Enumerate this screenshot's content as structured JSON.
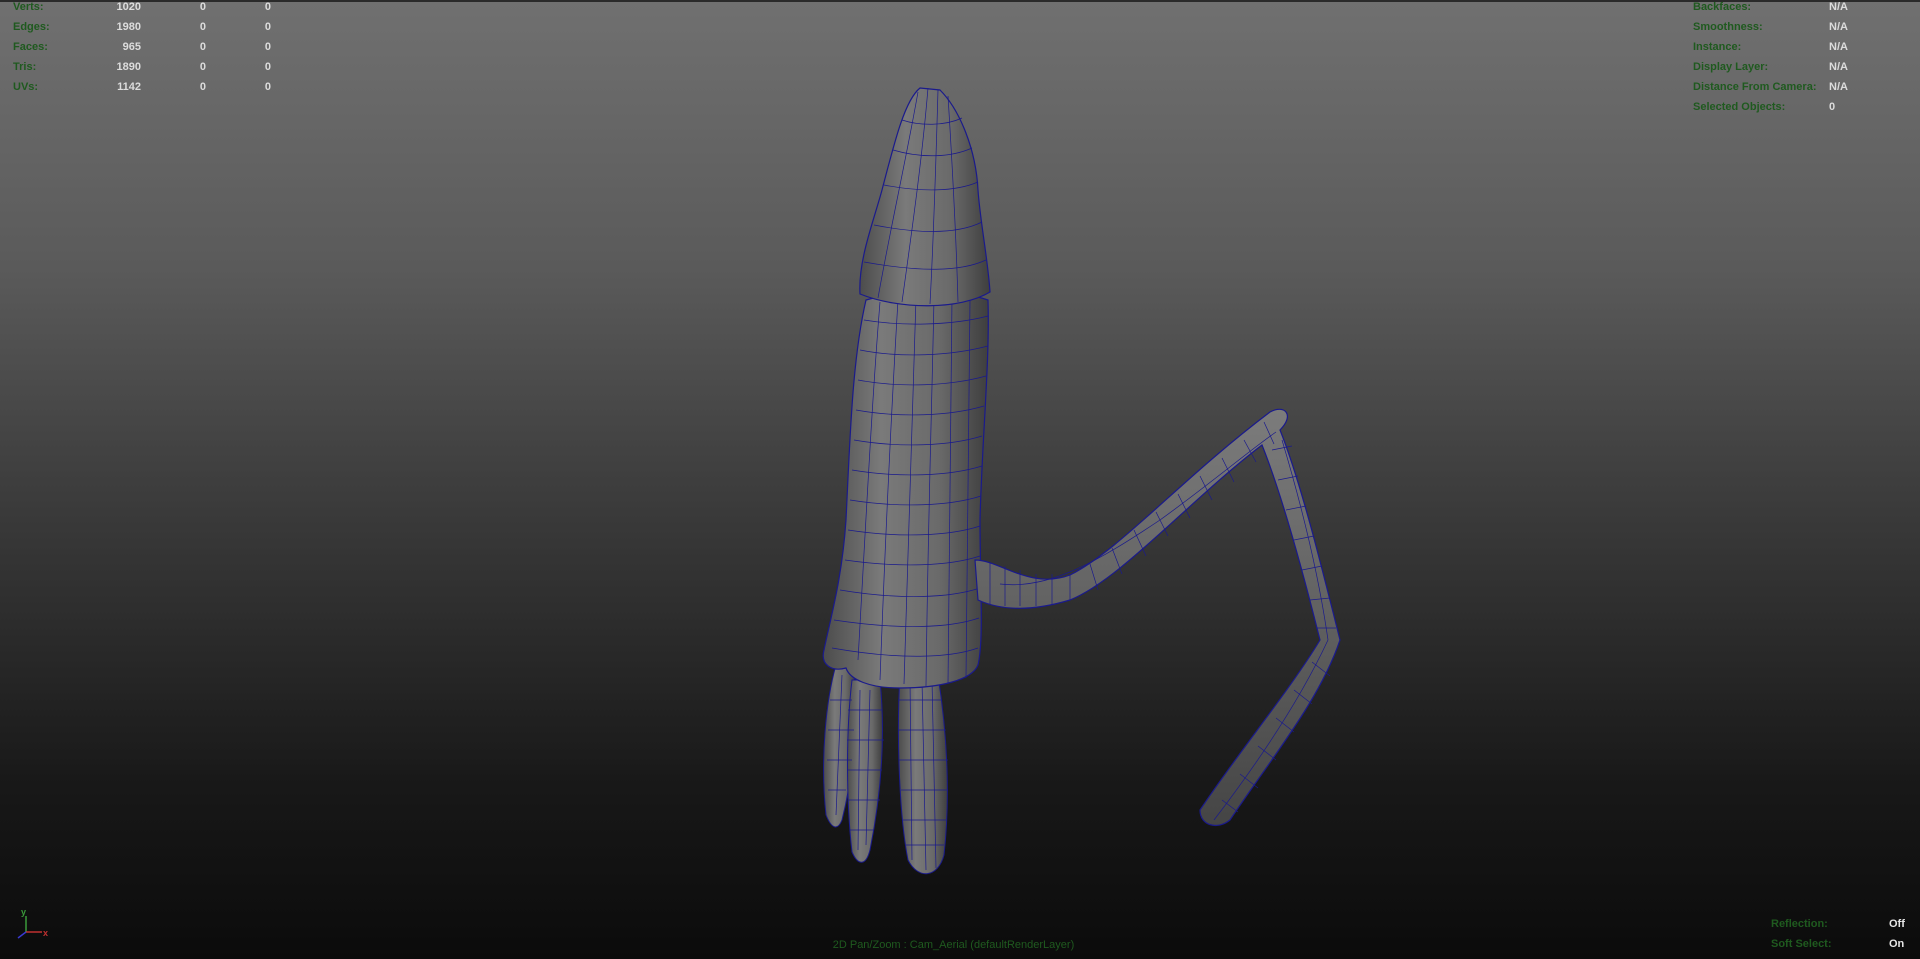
{
  "poly_count": {
    "rows": [
      {
        "label": "Verts:",
        "values": [
          "1020",
          "0",
          "0"
        ]
      },
      {
        "label": "Edges:",
        "values": [
          "1980",
          "0",
          "0"
        ]
      },
      {
        "label": "Faces:",
        "values": [
          "965",
          "0",
          "0"
        ]
      },
      {
        "label": "Tris:",
        "values": [
          "1890",
          "0",
          "0"
        ]
      },
      {
        "label": "UVs:",
        "values": [
          "1142",
          "0",
          "0"
        ]
      }
    ]
  },
  "object_details": {
    "rows": [
      {
        "label": "Backfaces:",
        "value": "N/A"
      },
      {
        "label": "Smoothness:",
        "value": "N/A"
      },
      {
        "label": "Instance:",
        "value": "N/A"
      },
      {
        "label": "Display Layer:",
        "value": "N/A"
      },
      {
        "label": "Distance From Camera:",
        "value": "N/A"
      },
      {
        "label": "Selected Objects:",
        "value": "0"
      }
    ]
  },
  "viewport_status": {
    "reflection_label": "Reflection:",
    "reflection_value": "Off",
    "soft_select_label": "Soft Select:",
    "soft_select_value": "On"
  },
  "camera_label": "2D Pan/Zoom : Cam_Aerial (defaultRenderLayer)",
  "axis": {
    "y": "y",
    "x": "x"
  },
  "colors": {
    "wireframe": "#1a1a8c",
    "hud_label": "#1f5a1f",
    "hud_value": "#dcdcdc",
    "mesh": "#6a6a6a"
  }
}
